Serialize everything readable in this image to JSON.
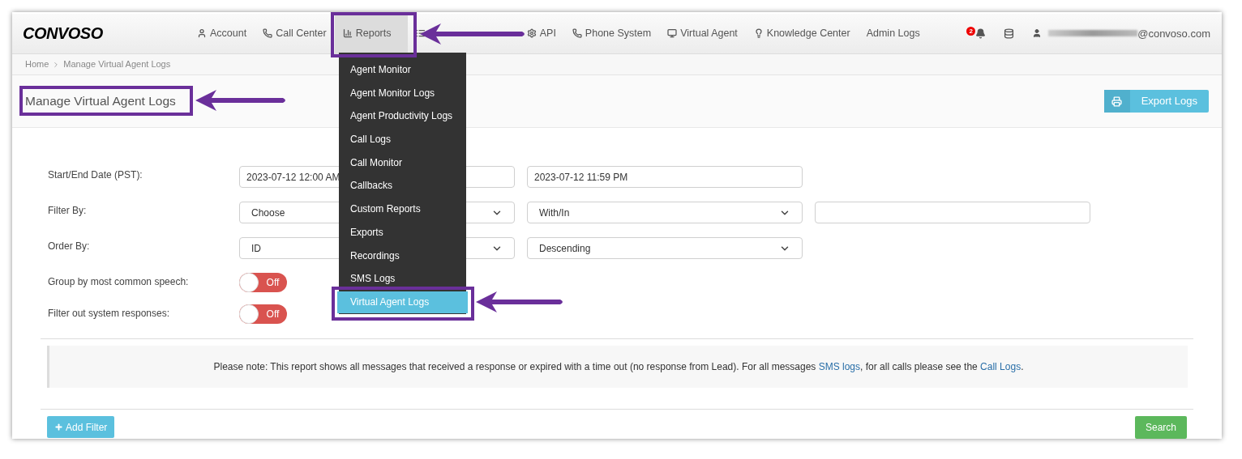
{
  "navbar": {
    "logo": "CONVOSO",
    "items": [
      {
        "label": "Account",
        "selected": false
      },
      {
        "label": "Call Center",
        "selected": false
      },
      {
        "label": "Reports",
        "selected": true
      },
      {
        "selected": false
      },
      {
        "label": "API",
        "selected": false
      },
      {
        "label": "Phone System",
        "selected": false
      },
      {
        "label": "Virtual Agent",
        "selected": false
      },
      {
        "label": "Knowledge Center",
        "selected": false
      },
      {
        "label": "Admin Logs",
        "selected": false
      }
    ],
    "notification_count": "2",
    "user_email": "@convoso.com"
  },
  "breadcrumb": [
    "Home",
    "Manage Virtual Agent Logs"
  ],
  "page_title": "Manage Virtual Agent Logs",
  "export_button": "Export Logs",
  "form": [
    {
      "kind": "fields",
      "label": "Start/End Date (PST):",
      "fields": [
        {
          "kind": "input",
          "value": "2023-07-12 12:00 AM"
        },
        {
          "kind": "input",
          "value": "2023-07-12 11:59 PM"
        }
      ]
    },
    {
      "kind": "fields",
      "label": "Filter By:",
      "fields": [
        {
          "kind": "select",
          "value": "Choose"
        },
        {
          "kind": "select",
          "value": "With/In"
        },
        {
          "kind": "input"
        }
      ]
    },
    {
      "kind": "fields",
      "label": "Order By:",
      "fields": [
        {
          "kind": "select",
          "value": "ID"
        },
        {
          "kind": "select",
          "value": "Descending"
        }
      ]
    },
    {
      "kind": "toggle",
      "label": "Group by most common speech:",
      "on": false,
      "state_text": "Off"
    },
    {
      "kind": "toggle",
      "label": "Filter out system responses:",
      "on": false,
      "state_text": "Off"
    }
  ],
  "reports_menu": [
    {
      "label": "Agent Monitor",
      "selected": false
    },
    {
      "label": "Agent Monitor Logs",
      "selected": false
    },
    {
      "label": "Agent Productivity Logs",
      "selected": false
    },
    {
      "label": "Call Logs",
      "selected": false
    },
    {
      "label": "Call Monitor",
      "selected": false
    },
    {
      "label": "Callbacks",
      "selected": false
    },
    {
      "label": "Custom Reports",
      "selected": false
    },
    {
      "label": "Exports",
      "selected": false
    },
    {
      "label": "Recordings",
      "selected": false
    },
    {
      "label": "SMS Logs",
      "selected": false
    },
    {
      "label": "Virtual Agent Logs",
      "selected": true
    }
  ],
  "note": {
    "parts": [
      {
        "kind": "text",
        "text": "Please note: This report shows all messages that received a response or expired with a time out (no response from Lead). For all messages "
      },
      {
        "kind": "link",
        "text": "SMS logs"
      },
      {
        "kind": "text",
        "text": ", for all calls please see the "
      },
      {
        "kind": "link",
        "text": "Call Logs"
      },
      {
        "kind": "text",
        "text": "."
      }
    ]
  },
  "add_filter_button": "Add Filter",
  "search_button": "Search"
}
